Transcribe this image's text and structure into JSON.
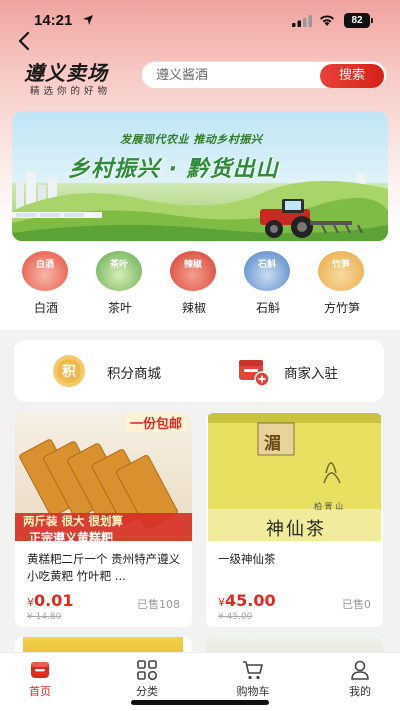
{
  "status_bar": {
    "time": "14:21",
    "battery": "82"
  },
  "header": {
    "logo_title": "遵义卖场",
    "logo_subtitle": "精选你的好物",
    "search_placeholder": "遵义酱酒",
    "search_button": "搜索"
  },
  "banner": {
    "tagline": "发展现代农业 推动乡村振兴",
    "title": "乡村振兴 · 黔货出山"
  },
  "categories": [
    {
      "icon_text": "白酒",
      "label": "白酒",
      "color": "#e64a3c"
    },
    {
      "icon_text": "茶叶",
      "label": "茶叶",
      "color": "#5fa84a"
    },
    {
      "icon_text": "辣椒",
      "label": "辣椒",
      "color": "#d73a2c"
    },
    {
      "icon_text": "石斛",
      "label": "石斛",
      "color": "#4a7fc4"
    },
    {
      "icon_text": "竹笋",
      "label": "方竹笋",
      "color": "#e8a63c"
    }
  ],
  "quick_links": [
    {
      "label": "积分商城",
      "icon_text": "积",
      "color": "#f0b94a"
    },
    {
      "label": "商家入驻",
      "color": "#e0433a"
    }
  ],
  "products": [
    {
      "name": "黄糕粑二斤一个 贵州特产遵义小吃黄粑 竹叶粑 ...",
      "price_symbol": "¥",
      "price": "0.01",
      "sold": "已售108",
      "old_price": "¥ 14.80",
      "img_top_text": "一份包邮",
      "img_tag": "两斤装 很大 很划算",
      "img_bottom_text": "正宗遵义黄糕粑"
    },
    {
      "name": "一级神仙茶",
      "price_symbol": "¥",
      "price": "45.00",
      "sold": "已售0",
      "old_price": "¥ 45.00",
      "img_side_text": "湄",
      "img_brand_text": "柏 箐 山",
      "img_bottom_text": "神仙茶"
    }
  ],
  "tabbar": [
    {
      "label": "首页",
      "active": true
    },
    {
      "label": "分类",
      "active": false
    },
    {
      "label": "购物车",
      "active": false
    },
    {
      "label": "我的",
      "active": false
    }
  ],
  "colors": {
    "accent": "#e0281f",
    "brand_green": "#2e8b3a"
  }
}
